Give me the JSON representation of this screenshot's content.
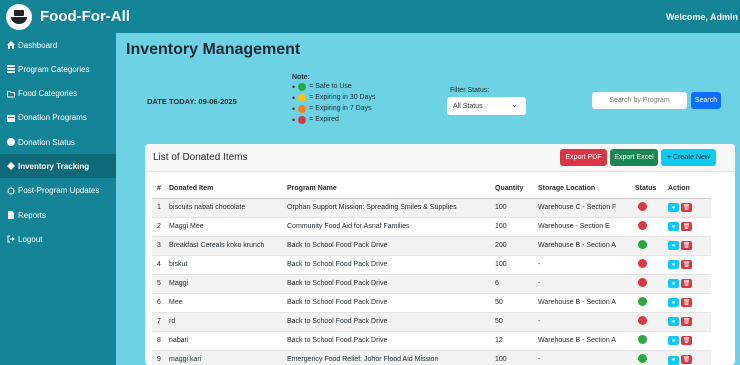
{
  "header": {
    "brand": "Food-For-All",
    "welcome": "Welcome, Admin"
  },
  "sidebar": {
    "items": [
      {
        "label": "Dashboard",
        "icon": "home-icon"
      },
      {
        "label": "Program Categories",
        "icon": "list-icon"
      },
      {
        "label": "Food Categories",
        "icon": "folder-icon"
      },
      {
        "label": "Donation Programs",
        "icon": "calendar-icon"
      },
      {
        "label": "Donation Status",
        "icon": "donation-icon"
      },
      {
        "label": "Inventory Tracking",
        "icon": "inventory-icon",
        "active": true
      },
      {
        "label": "Post-Program Updates",
        "icon": "refresh-icon"
      },
      {
        "label": "Reports",
        "icon": "file-icon"
      },
      {
        "label": "Logout",
        "icon": "logout-icon"
      }
    ]
  },
  "page": {
    "title": "Inventory Management",
    "date": "DATE TODAY: 09-06-2025"
  },
  "note": {
    "title": "Note:",
    "items": [
      {
        "color": "#28a745",
        "text": "= Safe to Use"
      },
      {
        "color": "#ffc107",
        "text": "= Expiring in 30 Days"
      },
      {
        "color": "#fd7e14",
        "text": "= Expiring in 7 Days"
      },
      {
        "color": "#dc3545",
        "text": "= Expired"
      }
    ]
  },
  "filter": {
    "label": "Filter Status:",
    "value": "All Status"
  },
  "search": {
    "placeholder": "Search by Program",
    "button": "Search"
  },
  "card": {
    "title": "List of Donated Items",
    "export_pdf": "Export PDF",
    "export_excel": "Export Excel",
    "create_new": "+ Create New"
  },
  "table": {
    "headers": [
      "#",
      "Donated Item",
      "Program Name",
      "Quantity",
      "Storage Location",
      "Status",
      "Action"
    ],
    "rows": [
      {
        "num": "1",
        "item": "biscuits nabati chocolate",
        "program": "Orphan Support Mission: Spreading Smiles & Supplies",
        "qty": "100",
        "location": "Warehouse C - Section F",
        "status": "#dc3545"
      },
      {
        "num": "2",
        "item": "Maggi Mee",
        "program": "Community Food Aid for Asnaf Families",
        "qty": "100",
        "location": "Warehouse - Section E",
        "status": "#dc3545"
      },
      {
        "num": "3",
        "item": "Breakfast Cereals koko krunch",
        "program": "Back to School Food Pack Drive",
        "qty": "200",
        "location": "Warehouse B - Section A",
        "status": "#28a745"
      },
      {
        "num": "4",
        "item": "biskut",
        "program": "Back to School Food Pack Drive",
        "qty": "100",
        "location": "-",
        "status": "#dc3545"
      },
      {
        "num": "5",
        "item": "Maggi",
        "program": "Back to School Food Pack Drive",
        "qty": "6",
        "location": "-",
        "status": "#dc3545"
      },
      {
        "num": "6",
        "item": "Mee",
        "program": "Back to School Food Pack Drive",
        "qty": "50",
        "location": "Warehouse B - Section A",
        "status": "#28a745"
      },
      {
        "num": "7",
        "item": "rd",
        "program": "Back to School Food Pack Drive",
        "qty": "50",
        "location": "-",
        "status": "#dc3545"
      },
      {
        "num": "8",
        "item": "nabati",
        "program": "Back to School Food Pack Drive",
        "qty": "12",
        "location": "Warehouse B - Section A",
        "status": "#28a745"
      },
      {
        "num": "9",
        "item": "maggi kari",
        "program": "Emergency Food Relief: Johor Flood Aid Mission",
        "qty": "100",
        "location": "-",
        "status": "#28a745"
      }
    ]
  }
}
